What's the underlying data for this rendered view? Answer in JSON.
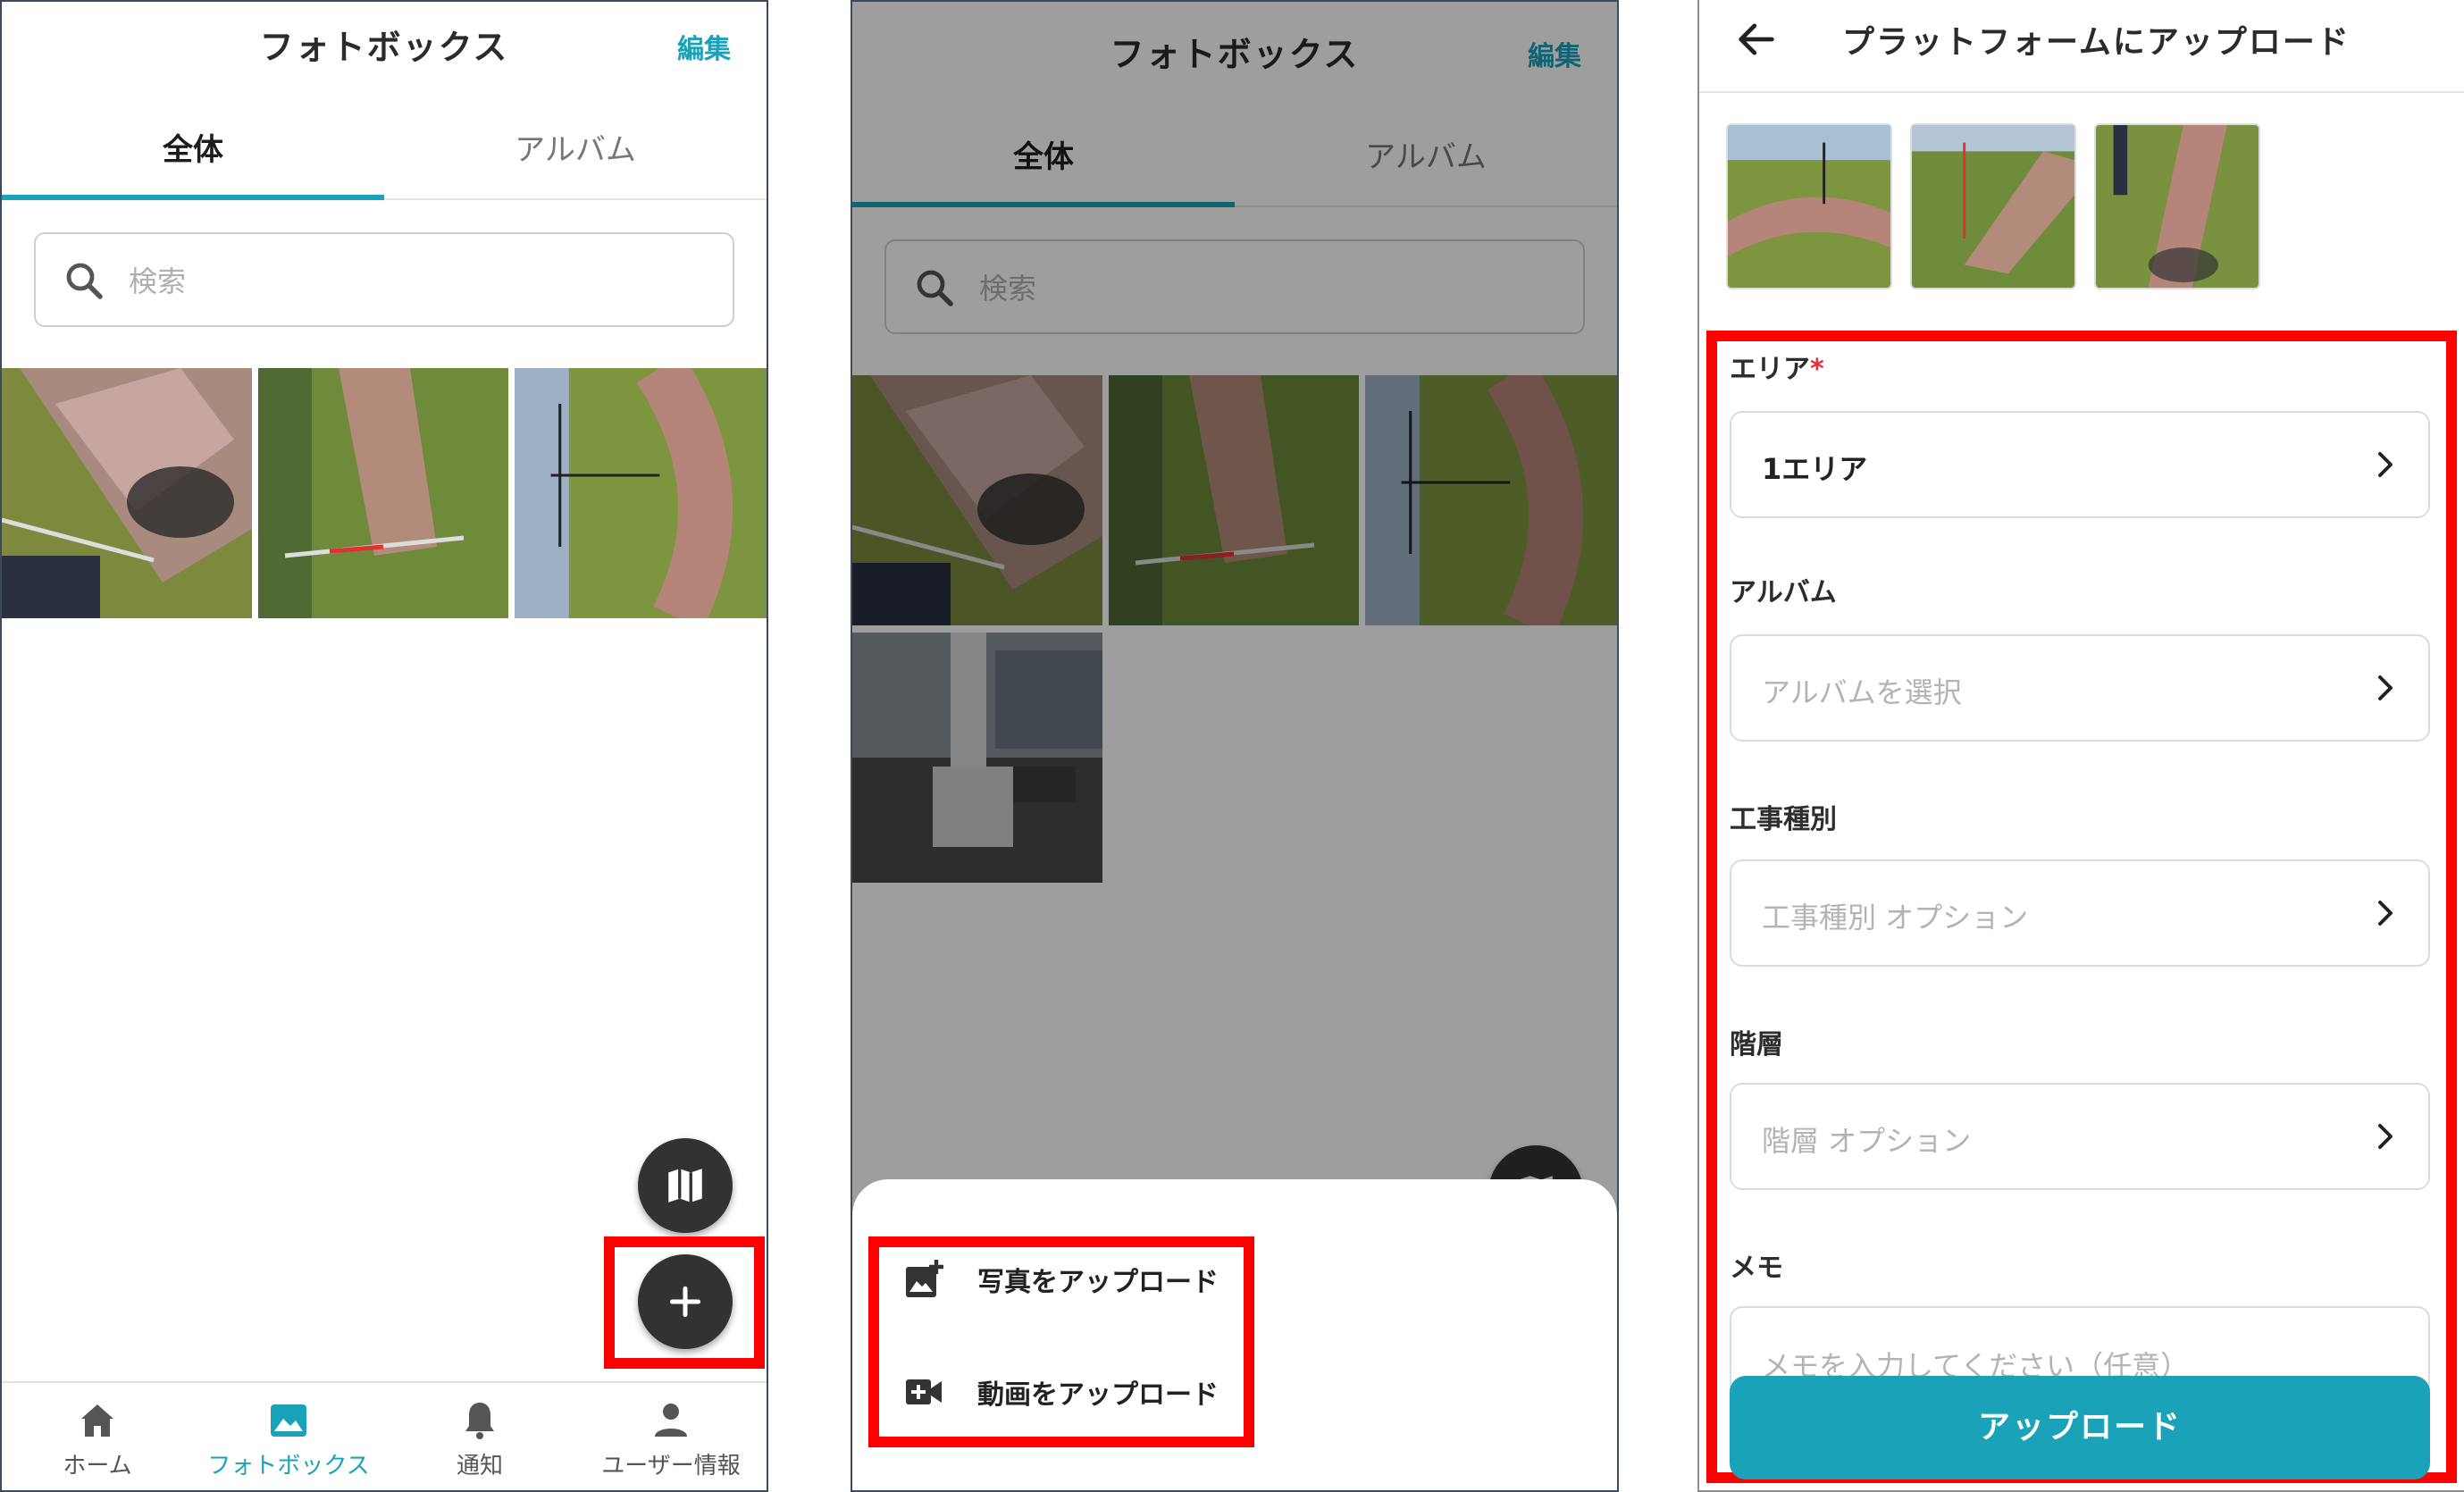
{
  "screen1": {
    "header": {
      "title": "フォトボックス",
      "edit_label": "編集"
    },
    "tabs": [
      {
        "label": "全体"
      },
      {
        "label": "アルバム"
      }
    ],
    "search": {
      "placeholder": "検索"
    },
    "nav": [
      {
        "label": "ホーム",
        "icon": "home-icon"
      },
      {
        "label": "フォトボックス",
        "icon": "photo-icon"
      },
      {
        "label": "通知",
        "icon": "bell-icon"
      },
      {
        "label": "ユーザー情報",
        "icon": "person-icon"
      }
    ]
  },
  "screen2": {
    "header": {
      "title": "フォトボックス",
      "edit_label": "編集"
    },
    "tabs": [
      {
        "label": "全体"
      },
      {
        "label": "アルバム"
      }
    ],
    "search": {
      "placeholder": "検索"
    },
    "sheet": {
      "photo_upload": "写真をアップロード",
      "video_upload": "動画をアップロード"
    }
  },
  "screen3": {
    "title": "プラットフォームにアップロード",
    "area": {
      "label": "エリア",
      "required_mark": "*",
      "value": "1エリア"
    },
    "album": {
      "label": "アルバム",
      "placeholder": "アルバムを選択"
    },
    "work_type": {
      "label": "工事種別",
      "placeholder": "工事種別 オプション"
    },
    "floor": {
      "label": "階層",
      "placeholder": "階層 オプション"
    },
    "memo": {
      "label": "メモ",
      "placeholder": "メモを入力してください（任意）"
    },
    "upload_label": "アップロード"
  },
  "colors": {
    "accent": "#1aa2b9",
    "highlight": "#ff0000",
    "fab": "#323232"
  }
}
